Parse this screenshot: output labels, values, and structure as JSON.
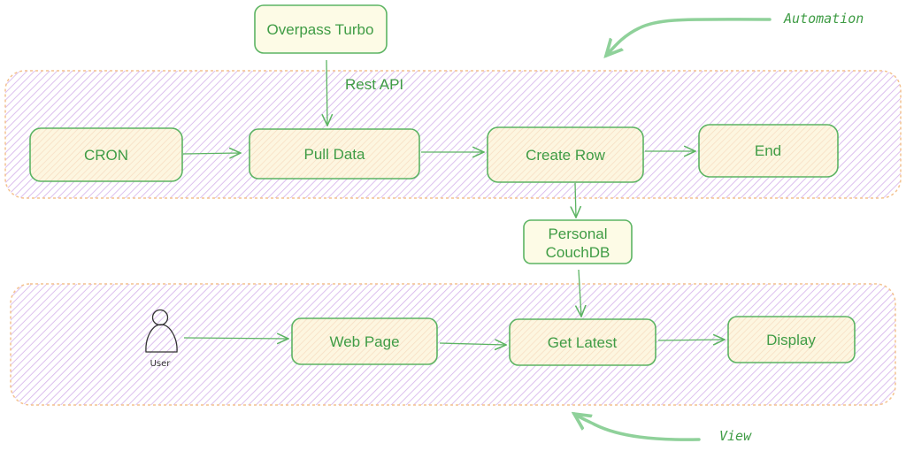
{
  "colors": {
    "stroke": "#5cb463",
    "text": "#3f9c45",
    "band_hatch": "#d4b0ea",
    "band_border": "#f4c28f",
    "box_fill": "#fdf3d6"
  },
  "annotations": {
    "automation": "Automation",
    "view": "View",
    "rest_api": "Rest API"
  },
  "nodes": {
    "overpass": "Overpass Turbo",
    "cron": "CRON",
    "pull_data": "Pull Data",
    "create_row": "Create Row",
    "end": "End",
    "couchdb_line1": "Personal",
    "couchdb_line2": "CouchDB",
    "web_page": "Web Page",
    "get_latest": "Get Latest",
    "display": "Display",
    "user": "User"
  }
}
